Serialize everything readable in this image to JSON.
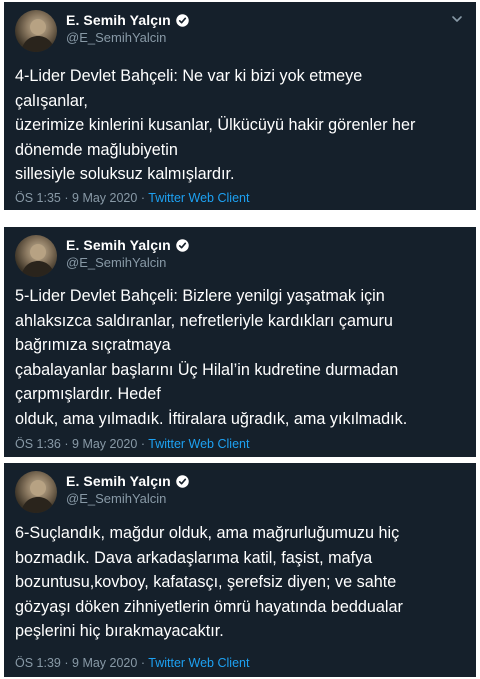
{
  "tweets": [
    {
      "display_name": "E. Semih Yalçın",
      "handle": "@E_SemihYalcin",
      "text": "4-Lider Devlet Bahçeli: Ne var ki bizi yok etmeye\nçalışanlar,\nüzerimize kinlerini kusanlar, Ülkücüyü hakir görenler her\ndönemde mağlubiyetin\nsillesiyle soluksuz kalmışlardır.",
      "time": "ÖS 1:35",
      "date": "9 May 2020",
      "separator": "·",
      "client": "Twitter Web Client"
    },
    {
      "display_name": "E. Semih Yalçın",
      "handle": "@E_SemihYalcin",
      "text": "5-Lider Devlet Bahçeli: Bizlere yenilgi yaşatmak için\nahlaksızca saldıranlar, nefretleriyle kardıkları çamuru\nbağrımıza sıçratmaya\nçabalayanlar başlarını Üç Hilal’in kudretine durmadan\nçarpmışlardır. Hedef\nolduk, ama yılmadık. İftiralara uğradık, ama yıkılmadık.",
      "time": "ÖS 1:36",
      "date": "9 May 2020",
      "separator": "·",
      "client": "Twitter Web Client"
    },
    {
      "display_name": "E. Semih Yalçın",
      "handle": "@E_SemihYalcin",
      "text": "6-Suçlandık, mağdur olduk, ama mağrurluğumuzu hiç\nbozmadık. Dava arkadaşlarıma katil, faşist, mafya\nbozuntusu,kovboy, kafatasçı, şerefsiz diyen; ve sahte\ngözyaşı döken zihniyetlerin ömrü hayatında beddualar\npeşlerini hiç bırakmayacaktır.",
      "time": "ÖS 1:39",
      "date": "9 May 2020",
      "separator": "·",
      "client": "Twitter Web Client"
    }
  ],
  "icons": {
    "verified": "verified-badge-icon",
    "more": "chevron-down-icon"
  },
  "colors": {
    "background": "#15202b",
    "text": "#ffffff",
    "secondary": "#8899a6",
    "accent": "#1da1f2"
  }
}
